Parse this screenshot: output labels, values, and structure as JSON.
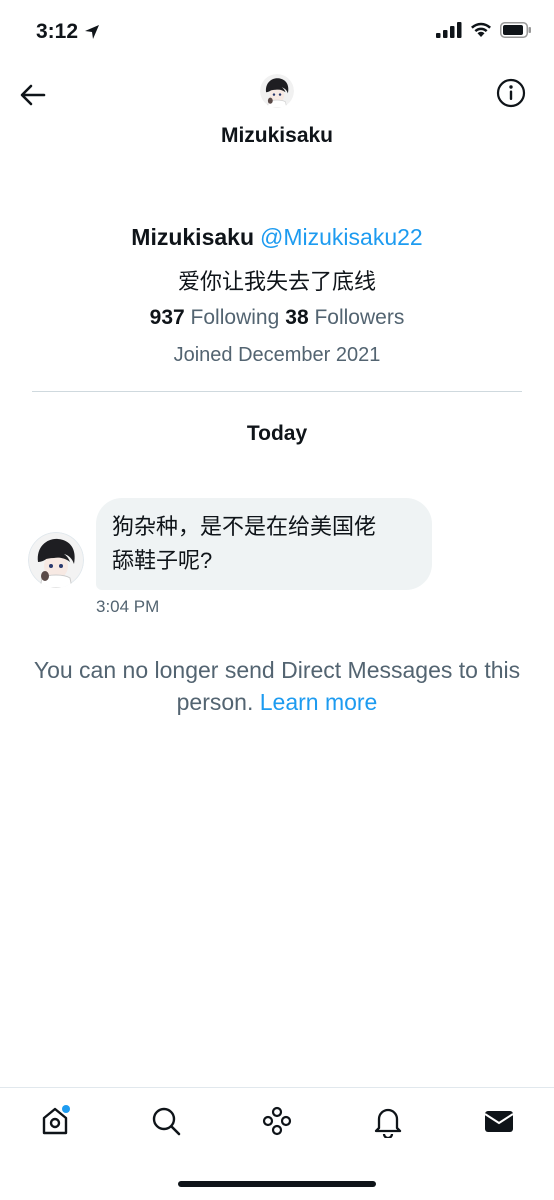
{
  "status_bar": {
    "time": "3:12",
    "icons": [
      "location-arrow-icon",
      "signal-icon",
      "wifi-icon",
      "battery-icon"
    ]
  },
  "header": {
    "title": "Mizukisaku",
    "icons": [
      "back-arrow-icon",
      "info-icon"
    ]
  },
  "profile": {
    "name": "Mizukisaku",
    "handle": "@Mizukisaku22",
    "bio": "爱你让我失去了底线",
    "following_count": "937",
    "following_label": "Following",
    "followers_count": "38",
    "followers_label": "Followers",
    "joined": "Joined December 2021"
  },
  "conversation": {
    "date_separator": "Today",
    "messages": [
      {
        "text_line1": "狗杂种，是不是在给美国佬",
        "text_line2": "舔鞋子呢?",
        "time": "3:04 PM"
      }
    ],
    "notice_text": "You can no longer send Direct Messages to this person.",
    "notice_link": "Learn more"
  },
  "bottom_nav": {
    "items": [
      "home-icon",
      "search-icon",
      "spaces-icon",
      "notifications-icon",
      "messages-icon"
    ],
    "home_has_badge": true
  },
  "colors": {
    "accent": "#1d9bf0",
    "text_primary": "#0f1419",
    "text_secondary": "#536471",
    "bubble": "#eff3f4"
  }
}
